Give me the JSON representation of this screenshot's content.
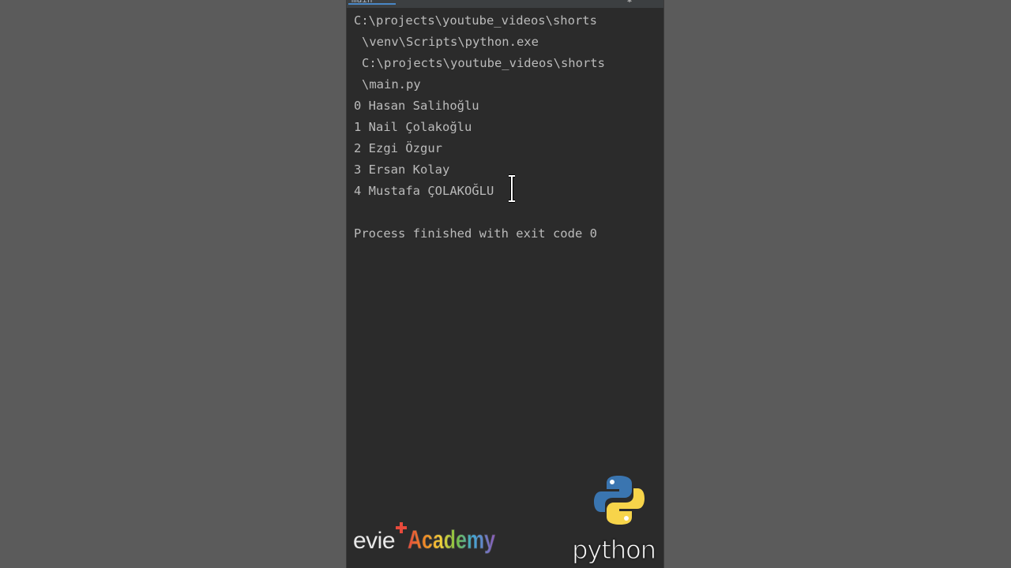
{
  "tab": {
    "label": "main"
  },
  "console": {
    "lines": [
      {
        "text": "C:\\projects\\youtube_videos\\shorts",
        "indent": false
      },
      {
        "text": "\\venv\\Scripts\\python.exe",
        "indent": true
      },
      {
        "text": "C:\\projects\\youtube_videos\\shorts",
        "indent": true
      },
      {
        "text": "\\main.py",
        "indent": true
      },
      {
        "text": "0 Hasan Salihoğlu",
        "indent": false
      },
      {
        "text": "1 Nail Çolakoğlu",
        "indent": false
      },
      {
        "text": "2 Ezgi Özgur",
        "indent": false
      },
      {
        "text": "3 Ersan Kolay",
        "indent": false
      },
      {
        "text": "4 Mustafa ÇOLAKOĞLU",
        "indent": false
      },
      {
        "text": "",
        "indent": false
      },
      {
        "text": "Process finished with exit code 0",
        "indent": false
      }
    ]
  },
  "branding": {
    "channel_prefix": "evie",
    "channel_suffix": "Academy",
    "language_label": "python"
  },
  "icons": {
    "settings": "gear-icon",
    "cursor": "text-cursor-icon",
    "python_logo": "python-logo-icon"
  },
  "colors": {
    "console_bg": "#2b2b2b",
    "console_text": "#bbbbbb",
    "outer_bg": "#5a5a5a",
    "python_blue": "#3a75b0",
    "python_yellow": "#f7d44a"
  }
}
